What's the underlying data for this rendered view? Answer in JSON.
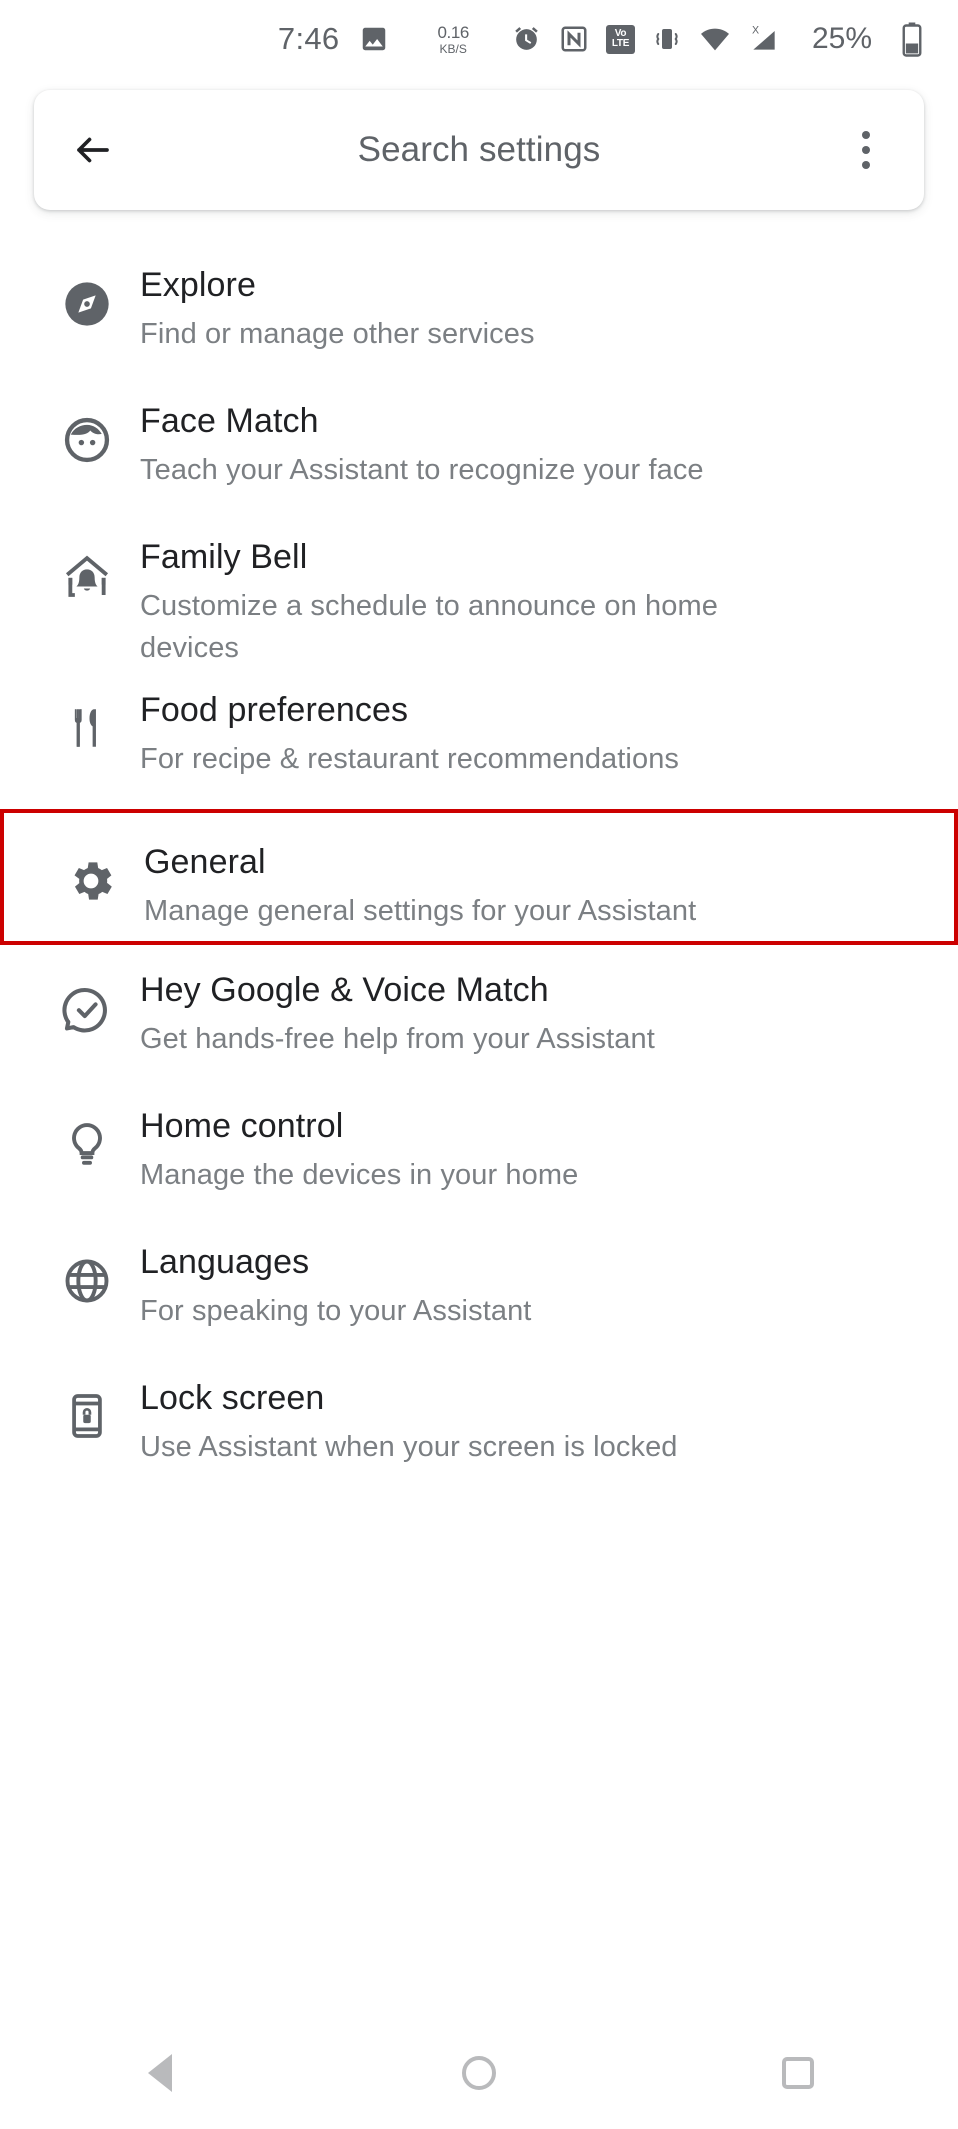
{
  "status_bar": {
    "time": "7:46",
    "gallery_icon": "image-icon",
    "net_speed_value": "0.16",
    "net_speed_unit": "KB/S",
    "alarm_icon": "alarm-icon",
    "nfc_icon": "nfc-icon",
    "volte_top": "Vo",
    "volte_bottom": "LTE",
    "vibrate_icon": "vibrate-icon",
    "wifi_icon": "wifi-icon",
    "signal_icon": "mobile-signal-off-icon",
    "battery_percent": "25%",
    "battery_icon": "battery-icon"
  },
  "appbar": {
    "back_icon": "back-arrow-icon",
    "title": "Search settings",
    "overflow_icon": "more-vertical-icon"
  },
  "settings_items": [
    {
      "icon": "compass-icon",
      "title": "Explore",
      "subtitle": "Find or manage other services",
      "highlighted": false
    },
    {
      "icon": "face-icon",
      "title": "Face Match",
      "subtitle": "Teach your Assistant to recognize your face",
      "highlighted": false
    },
    {
      "icon": "home-bell-icon",
      "title": "Family Bell",
      "subtitle": "Customize a schedule to announce on home devices",
      "highlighted": false
    },
    {
      "icon": "fork-knife-icon",
      "title": "Food preferences",
      "subtitle": "For recipe & restaurant recommendations",
      "highlighted": false
    },
    {
      "icon": "gear-icon",
      "title": "General",
      "subtitle": "Manage general settings for your Assistant",
      "highlighted": true
    },
    {
      "icon": "check-circle-icon",
      "title": "Hey Google & Voice Match",
      "subtitle": "Get hands-free help from your Assistant",
      "highlighted": false
    },
    {
      "icon": "lightbulb-icon",
      "title": "Home control",
      "subtitle": "Manage the devices in your home",
      "highlighted": false
    },
    {
      "icon": "globe-icon",
      "title": "Languages",
      "subtitle": "For speaking to your Assistant",
      "highlighted": false
    },
    {
      "icon": "phone-lock-icon",
      "title": "Lock screen",
      "subtitle": "Use Assistant when your screen is locked",
      "highlighted": false
    }
  ],
  "navbar": {
    "back_label": "back-triangle-icon",
    "home_label": "home-circle-icon",
    "recents_label": "recents-square-icon"
  },
  "colors": {
    "highlight": "#cc0000",
    "title_text": "#202124",
    "subtitle_text": "#7b7f83",
    "icon": "#5f6368"
  }
}
